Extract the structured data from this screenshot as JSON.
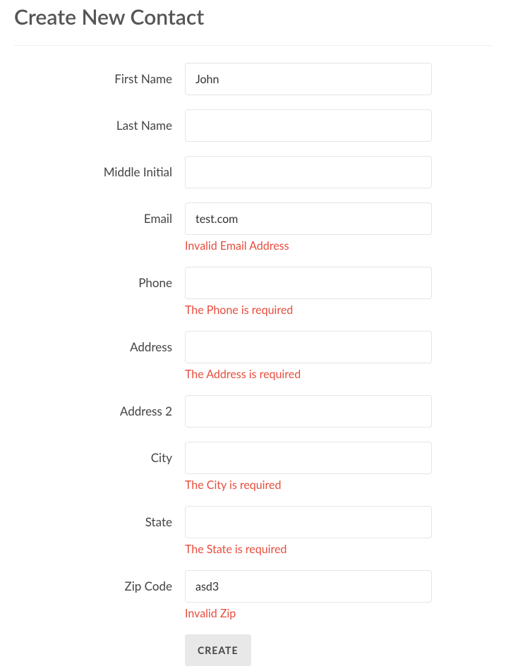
{
  "title": "Create New Contact",
  "fields": {
    "first_name": {
      "label": "First Name",
      "value": "John",
      "error": ""
    },
    "last_name": {
      "label": "Last Name",
      "value": "",
      "error": ""
    },
    "middle_initial": {
      "label": "Middle Initial",
      "value": "",
      "error": ""
    },
    "email": {
      "label": "Email",
      "value": "test.com",
      "error": "Invalid Email Address"
    },
    "phone": {
      "label": "Phone",
      "value": "",
      "error": "The Phone is required"
    },
    "address": {
      "label": "Address",
      "value": "",
      "error": "The Address is required"
    },
    "address2": {
      "label": "Address 2",
      "value": "",
      "error": ""
    },
    "city": {
      "label": "City",
      "value": "",
      "error": "The City is required"
    },
    "state": {
      "label": "State",
      "value": "",
      "error": "The State is required"
    },
    "zip": {
      "label": "Zip Code",
      "value": "asd3",
      "error": "Invalid Zip"
    }
  },
  "submit_label": "CREATE"
}
